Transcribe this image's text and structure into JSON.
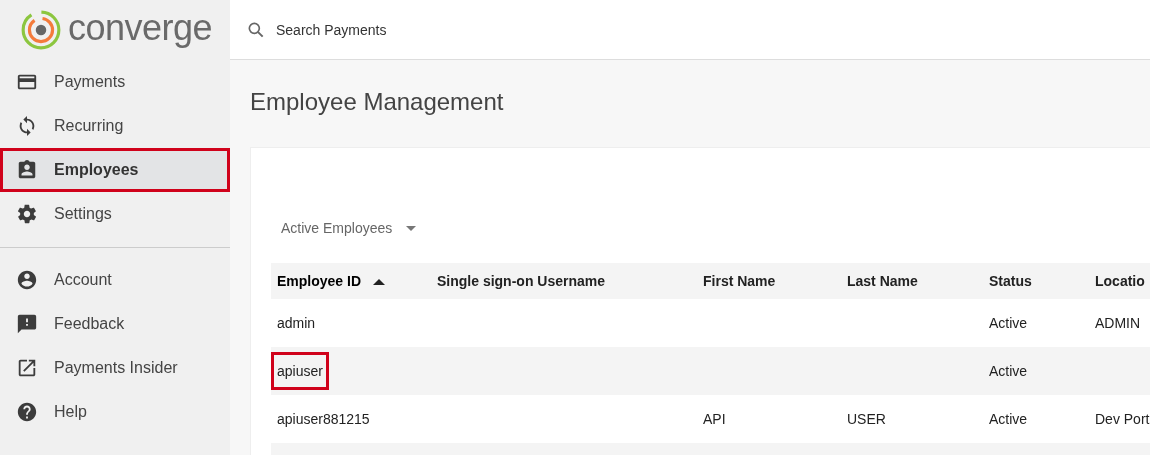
{
  "logo": {
    "text": "converge"
  },
  "search": {
    "placeholder": "Search Payments"
  },
  "sidebar": {
    "groups": [
      {
        "items": [
          {
            "label": "Payments",
            "selected": false,
            "highlighted": false
          },
          {
            "label": "Recurring",
            "selected": false,
            "highlighted": false
          },
          {
            "label": "Employees",
            "selected": true,
            "highlighted": true
          },
          {
            "label": "Settings",
            "selected": false,
            "highlighted": false
          }
        ]
      },
      {
        "items": [
          {
            "label": "Account",
            "selected": false,
            "highlighted": false
          },
          {
            "label": "Feedback",
            "selected": false,
            "highlighted": false
          },
          {
            "label": "Payments Insider",
            "selected": false,
            "highlighted": false
          },
          {
            "label": "Help",
            "selected": false,
            "highlighted": false
          }
        ]
      }
    ]
  },
  "page_title": "Employee Management",
  "filter": {
    "value": "Active Employees"
  },
  "table": {
    "columns": [
      {
        "label": "Employee ID",
        "sorted": true
      },
      {
        "label": "Single sign-on Username",
        "sorted": false
      },
      {
        "label": "First Name",
        "sorted": false
      },
      {
        "label": "Last Name",
        "sorted": false
      },
      {
        "label": "Status",
        "sorted": false
      },
      {
        "label": "Locatio",
        "sorted": false
      }
    ],
    "rows": [
      {
        "cells": [
          "admin",
          null,
          null,
          null,
          "Active",
          "ADMIN"
        ],
        "first_cell_highlighted": false
      },
      {
        "cells": [
          "apiuser",
          null,
          null,
          null,
          "Active",
          null
        ],
        "first_cell_highlighted": true
      },
      {
        "cells": [
          "apiuser881215",
          null,
          "API",
          "USER",
          "Active",
          "Dev Port"
        ],
        "first_cell_highlighted": false
      },
      {
        "cells": [
          null,
          null,
          null,
          null,
          null,
          null
        ]
      }
    ]
  }
}
